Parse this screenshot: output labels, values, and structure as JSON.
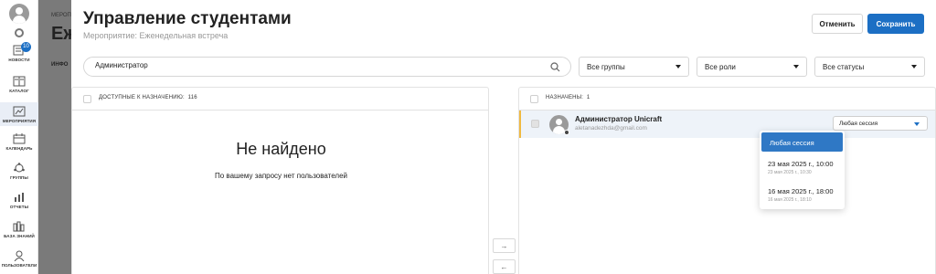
{
  "sidebar": {
    "items": [
      {
        "label": "НОВОСТИ",
        "icon": "news-icon",
        "badge": "10"
      },
      {
        "label": "КАТАЛОГ",
        "icon": "catalog-icon"
      },
      {
        "label": "МЕРОПРИЯТИЯ",
        "icon": "events-icon",
        "active": true
      },
      {
        "label": "КАЛЕНДАРЬ",
        "icon": "calendar-icon"
      },
      {
        "label": "ГРУППЫ",
        "icon": "groups-icon"
      },
      {
        "label": "ОТЧЕТЫ",
        "icon": "reports-icon"
      },
      {
        "label": "БАЗА ЗНАНИЙ",
        "icon": "knowledge-base-icon"
      },
      {
        "label": "ПОЛЬЗОВАТЕЛИ",
        "icon": "users-icon"
      }
    ]
  },
  "background_page": {
    "breadcrumb": "МЕРОП",
    "title": "Еж",
    "tab": "ИНФО"
  },
  "modal": {
    "title": "Управление студентами",
    "subtitle": "Мероприятие: Еженедельная встреча",
    "cancel_label": "Отменить",
    "save_label": "Сохранить"
  },
  "filters": {
    "search_value": "Администратор",
    "groups": "Все группы",
    "roles": "Все роли",
    "statuses": "Все статусы"
  },
  "available": {
    "header": "ДОСТУПНЫЕ К НАЗНАЧЕНИЮ:",
    "count": "116",
    "empty_title": "Не найдено",
    "empty_subtitle": "По вашему запросу нет пользователей"
  },
  "transfer": {
    "add_label": "→",
    "remove_label": "←"
  },
  "assigned": {
    "header": "НАЗНАЧЕНЫ:",
    "count": "1",
    "user": {
      "name": "Администратор Unicraft",
      "email": "aletanadezhda@gmail.com",
      "session": "Любая сессия"
    }
  },
  "session_menu": {
    "options": [
      {
        "label": "Любая сессия",
        "selected": true
      },
      {
        "label": "23 мая 2025 г., 10:00",
        "sub": "23 мая 2025 г., 10:30"
      },
      {
        "label": "16 мая 2025 г., 18:00",
        "sub": "16 мая 2025 г., 18:10"
      }
    ]
  },
  "colors": {
    "accent": "#1c6fc4",
    "highlight": "#f0b940",
    "row_bg": "#eef3f9"
  }
}
